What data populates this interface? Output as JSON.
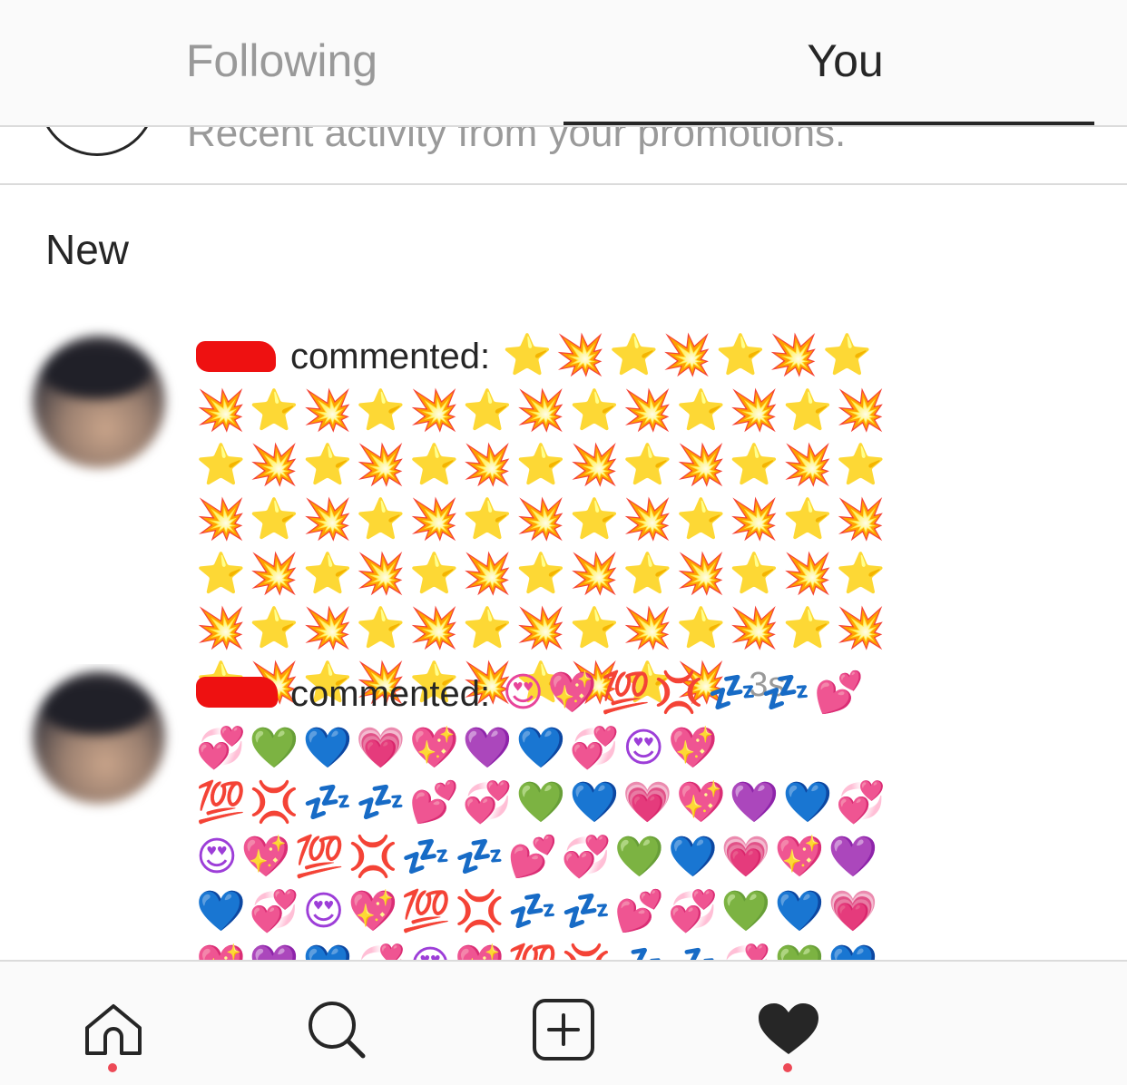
{
  "tabs": {
    "following": "Following",
    "you": "You"
  },
  "promotions": {
    "text": "Recent activity from your promotions."
  },
  "section": {
    "title": "New"
  },
  "notifications": [
    {
      "action": "commented:",
      "comment_line1": "⭐💥⭐💥⭐💥⭐",
      "comment_rest": "💥⭐💥⭐💥⭐💥⭐💥⭐💥⭐💥⭐💥⭐💥⭐💥⭐💥⭐💥⭐💥⭐💥⭐💥⭐💥⭐💥⭐💥⭐💥⭐💥⭐💥⭐💥⭐💥⭐💥⭐💥⭐💥⭐💥⭐💥⭐💥⭐💥⭐💥⭐💥⭐💥⭐💥⭐💥⭐💥⭐💥⭐💥",
      "time": "3s"
    },
    {
      "action": "commented:",
      "comment_line1": "😍💖💯💢💤💤💕",
      "comment_rest": "💞💚💙💗💖💜💙💞😍💖💯💢💤💤💕💞💚💙💗💖💜💙💞😍💖💯💢💤💤💕💞💚💙💗💖💜💙💞😍💖💯💢💤💤💕💞💚💙💗💖💜💙💞😍💖💯💢💤💤💞💚💙💗💖💜💙💞😍💖💯💢💤💤💕"
    }
  ],
  "bottom_nav": {
    "icons": [
      "home-icon",
      "search-icon",
      "add-post-icon",
      "heart-icon"
    ],
    "active": "heart-icon",
    "dot_color": "#ed4956"
  }
}
